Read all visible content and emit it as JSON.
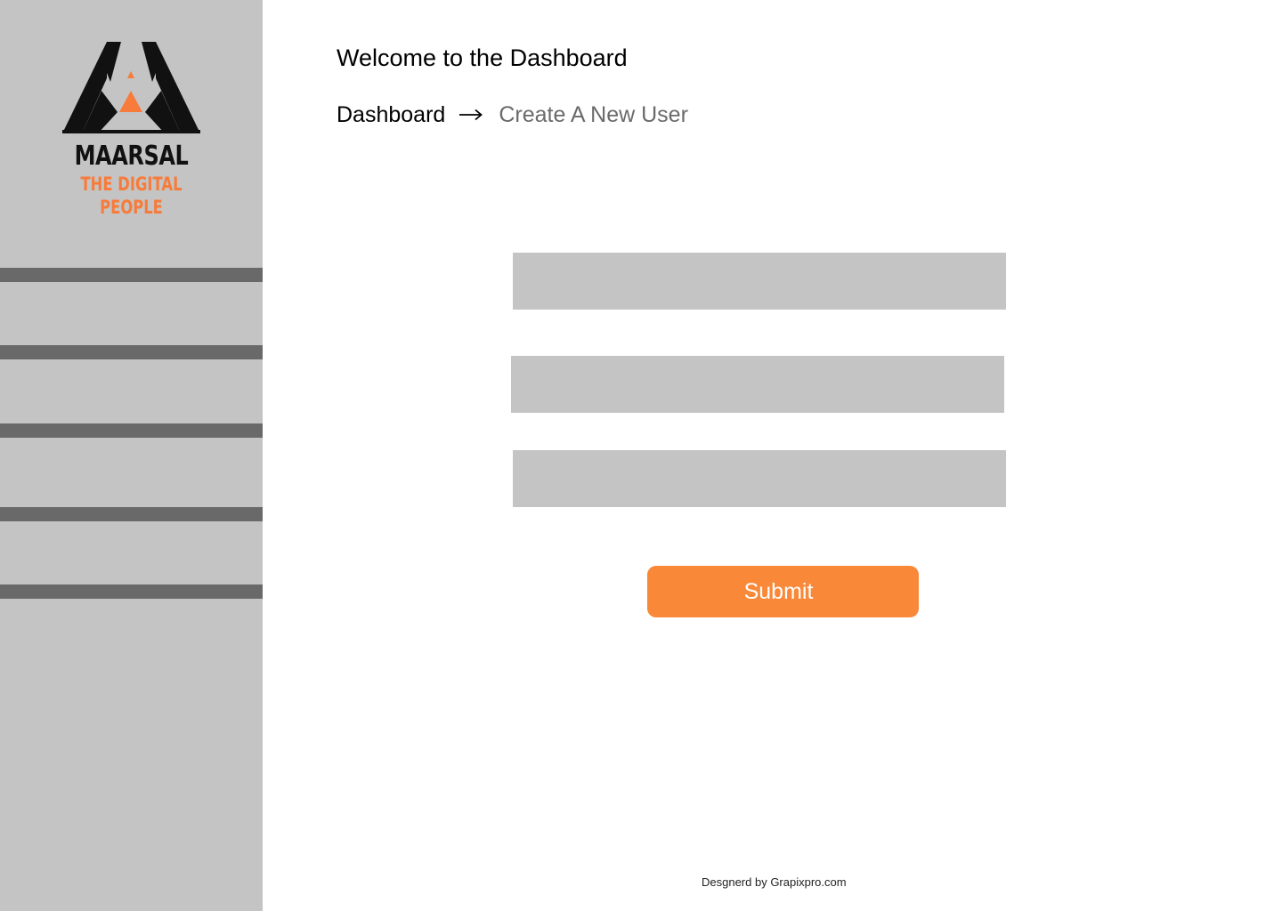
{
  "brand": {
    "name": "MAARSAL",
    "tagline": "THE DIGITAL PEOPLE",
    "colors": {
      "accent": "#f77b3a",
      "dark": "#111111"
    }
  },
  "sidebar": {
    "background": "#c4c4c4",
    "divider_color": "#696969",
    "items": [
      {
        "label": ""
      },
      {
        "label": ""
      },
      {
        "label": ""
      },
      {
        "label": ""
      }
    ]
  },
  "header": {
    "title": "Welcome to the Dashboard"
  },
  "breadcrumb": {
    "home": "Dashboard",
    "separator_icon": "arrow-right-icon",
    "current": "Create A New User"
  },
  "form": {
    "fields": [
      {
        "value": "",
        "placeholder": ""
      },
      {
        "value": "",
        "placeholder": ""
      },
      {
        "value": "",
        "placeholder": ""
      }
    ],
    "submit_label": "Submit",
    "submit_color": "#f98838"
  },
  "footer": {
    "credit": "Desgnerd by Grapixpro.com"
  }
}
